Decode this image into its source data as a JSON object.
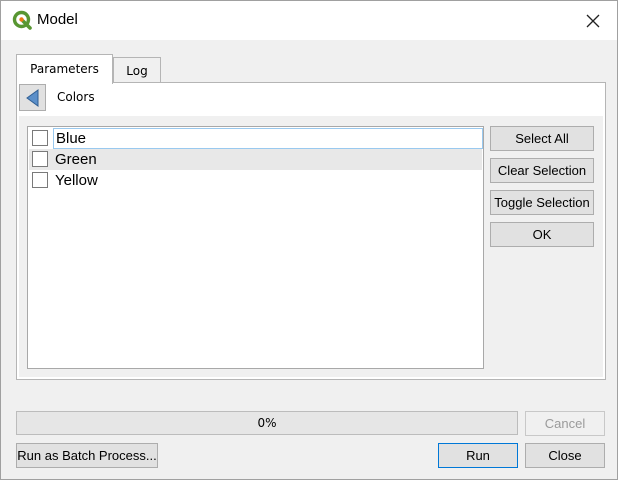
{
  "window": {
    "title": "Model",
    "icon": "qgis-logo-icon",
    "accent": "#589632"
  },
  "tabs": [
    {
      "label": "Parameters",
      "active": true
    },
    {
      "label": "Log",
      "active": false
    }
  ],
  "breadcrumb": {
    "back_icon": "back-arrow-icon",
    "label": "Colors"
  },
  "options": [
    {
      "label": "Blue",
      "checked": false
    },
    {
      "label": "Green",
      "checked": false
    },
    {
      "label": "Yellow",
      "checked": false
    }
  ],
  "side_buttons": {
    "select_all": "Select All",
    "clear_selection": "Clear Selection",
    "toggle_selection": "Toggle Selection",
    "ok": "OK"
  },
  "progress": {
    "value": 0,
    "text": "0%"
  },
  "footer": {
    "cancel": "Cancel",
    "batch": "Run as Batch Process...",
    "run": "Run",
    "close": "Close"
  }
}
